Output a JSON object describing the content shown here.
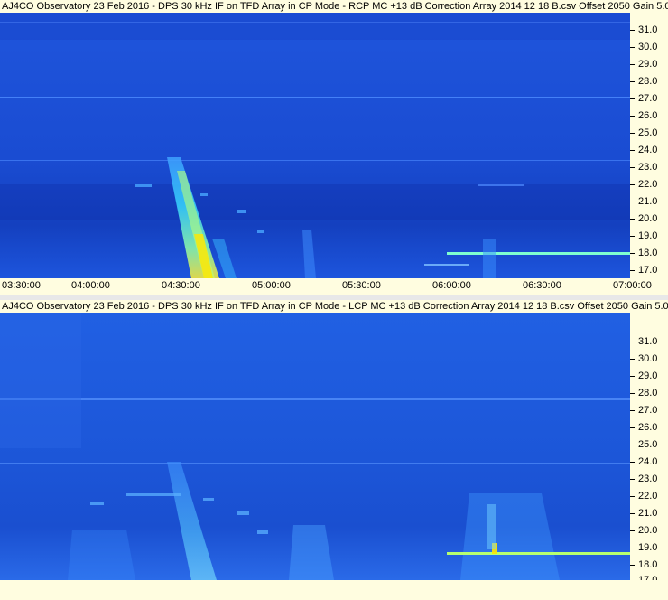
{
  "top_panel": {
    "title": "AJ4CO Observatory 23 Feb 2016 - DPS 30 kHz IF on TFD Array in CP Mode - RCP  MC +13 dB  Correction Array 2014 12 18 B.csv  Offset 2050  Gain 5.0"
  },
  "bottom_panel": {
    "title": "AJ4CO Observatory 23 Feb 2016 - DPS 30 kHz IF on TFD Array in CP Mode - LCP  MC +13 dB  Correction Array 2014 12 18 B.csv  Offset 2050  Gain 5.0"
  },
  "frequency_ticks": [
    "31.0",
    "30.0",
    "29.0",
    "28.0",
    "27.0",
    "26.0",
    "25.0",
    "24.0",
    "23.0",
    "22.0",
    "21.0",
    "20.0",
    "19.0",
    "18.0",
    "17.0"
  ],
  "time_ticks": [
    "03:30:00",
    "04:00:00",
    "04:30:00",
    "05:00:00",
    "05:30:00",
    "06:00:00",
    "06:30:00",
    "07:00:00"
  ],
  "colors": {
    "background": "#fffde0",
    "spectrogram_base": "#1a4fd6",
    "spectrogram_dark": "#0f2fa8",
    "burst_hot": "#ffe600"
  }
}
